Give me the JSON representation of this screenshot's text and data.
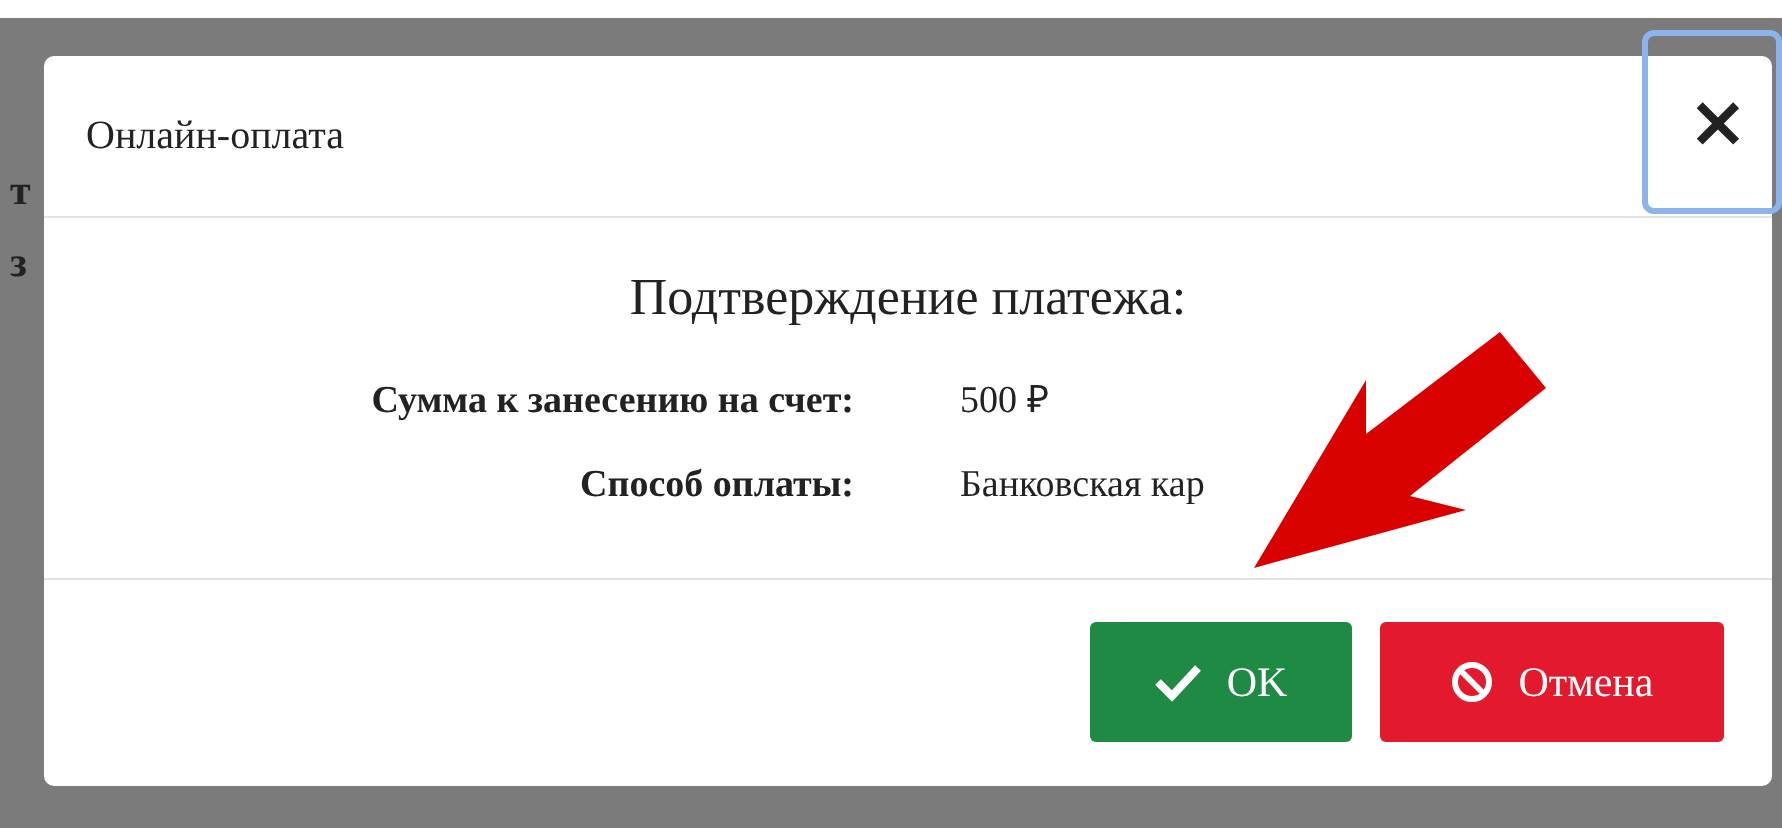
{
  "background_text": [
    "т",
    "з"
  ],
  "dialog": {
    "title": "Онлайн-оплата",
    "close": "×",
    "heading": "Подтверждение платежа:",
    "fields": [
      {
        "label": "Сумма к занесению на счет:",
        "value": "500 ₽"
      },
      {
        "label": "Способ оплаты:",
        "value": "Банковская кар"
      }
    ],
    "buttons": [
      {
        "kind": "confirm",
        "label": "OK"
      },
      {
        "kind": "cancel",
        "label": "Отмена"
      }
    ]
  }
}
